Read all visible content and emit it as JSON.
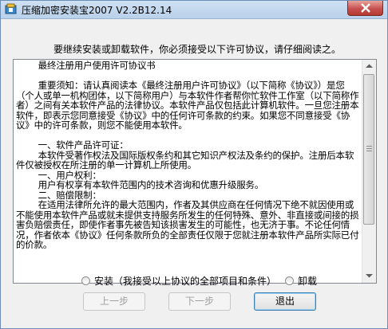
{
  "window": {
    "title": "压缩加密安装宝2007 V2.2B12.14",
    "icon": "app-icon"
  },
  "instruction": "要继续安装或卸载软件，你必须接受以下许可协议，请仔细阅读之。",
  "license": {
    "text": "        最终注册用户使用许可协议书\n\n        重要须知：请认真阅读本《最终注册用户许可协议》（以下简称《协议》）是您（个人或单一机构团体，以下简称用户）与本软件作者帮你忙软件工作室（以下简称作者）之间有关本软件产品的法律协议。本软件产品仅包括此计算机软件。一旦您注册本软件，即表示您同意接受《协议》中的任何许可条款的约束。如果您不同意接受《协议》中的许可条款，则您不能使用本软件。\n\n        一、软件产品许可证：\n        本软件受著作权法及国际版权条约和其它知识产权法及条约的保护。注册后本软件仅被授权在所注册的单一计算机上所使用。\n        一、用户权利：\n        用户有权享有本软件范围内的技术咨询和优惠升级服务。\n        二、赔偿限制：\n        在适用法律所允许的最大范围内，作者及其供应商在任何情况下绝不就因使用或不能使用本软件产品或就未提供支持服务所发生的任何特殊、意外、非直接或间接的损害负赔偿责任，即使作者事先被告知该损害发生的可能性，也无济于事。不论任何情况，作者依本《协议》任何条款所负的全部责任仅限于您就注册本软件产品所实际已付的价款。"
  },
  "options": {
    "install": "安装（我接受以上协议的全部项目和条件）",
    "uninstall": "卸载"
  },
  "buttons": {
    "prev": "上一步",
    "next": "下一步",
    "exit": "退出"
  }
}
